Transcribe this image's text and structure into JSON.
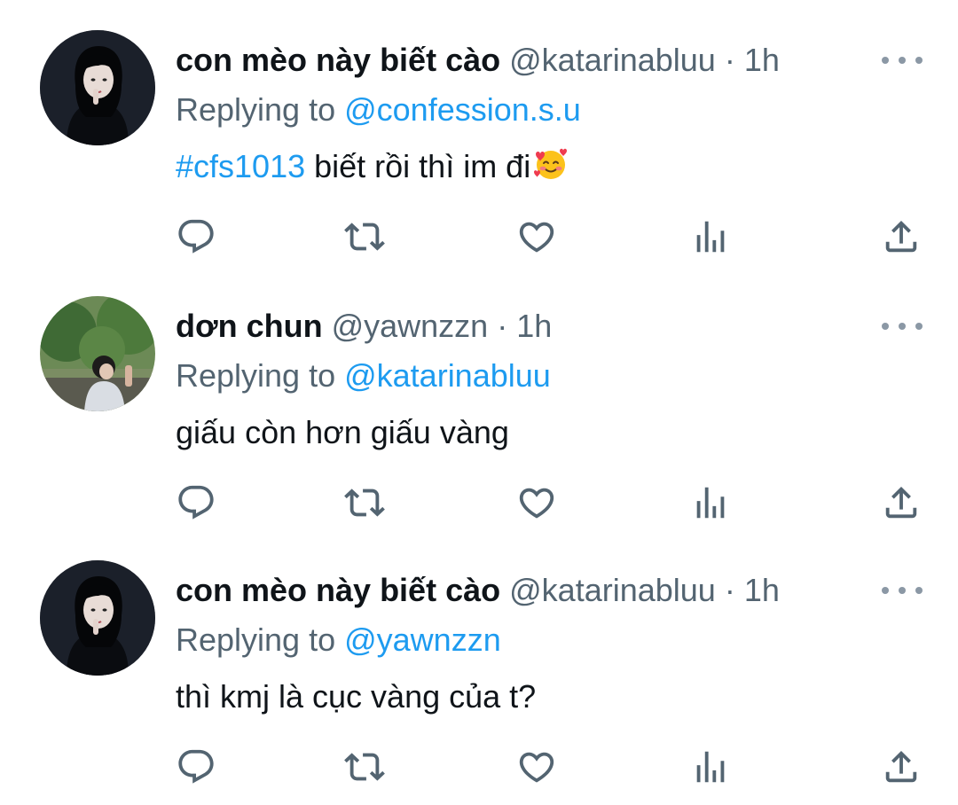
{
  "colors": {
    "accent": "#1d9bf0",
    "muted": "#536471",
    "text": "#0f1419"
  },
  "tweets": [
    {
      "name": "con mèo này biết cào",
      "handle": "@katarinabluu",
      "separator": "·",
      "time": "1h",
      "replying_prefix": "Replying to ",
      "replying_to": "@confession.s.u",
      "hashtag": "#cfs1013",
      "text": " biết rồi thì im đi",
      "emoji": "smiling-face-with-hearts-icon"
    },
    {
      "name": "dơn chun",
      "handle": "@yawnzzn",
      "separator": "·",
      "time": "1h",
      "replying_prefix": "Replying to ",
      "replying_to": "@katarinabluu",
      "hashtag": "",
      "text": "giấu còn hơn giấu vàng"
    },
    {
      "name": "con mèo này biết cào",
      "handle": "@katarinabluu",
      "separator": "·",
      "time": "1h",
      "replying_prefix": "Replying to ",
      "replying_to": "@yawnzzn",
      "hashtag": "",
      "text": "thì kmj là cục vàng của t?"
    }
  ],
  "icons": {
    "more": "more-options-icon",
    "reply": "reply-icon",
    "retweet": "retweet-icon",
    "like": "heart-icon",
    "views": "analytics-icon",
    "share": "share-icon"
  }
}
